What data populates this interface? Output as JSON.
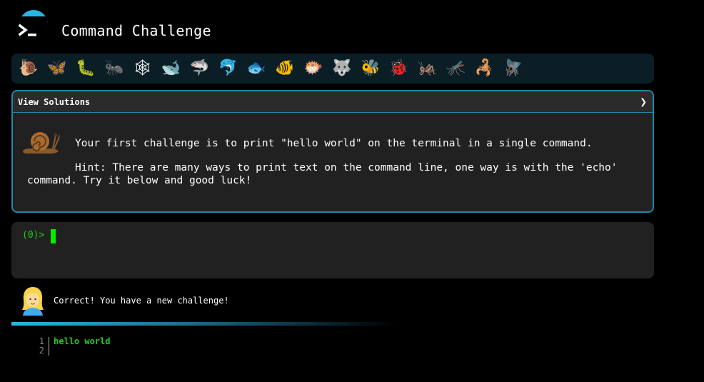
{
  "header": {
    "title": "Command Challenge",
    "logo_icon": "terminal-prompt-icon"
  },
  "animals": [
    {
      "name": "snail",
      "glyph": "🐌"
    },
    {
      "name": "butterfly",
      "glyph": "🦋"
    },
    {
      "name": "bug",
      "glyph": "🐛"
    },
    {
      "name": "ant",
      "glyph": "🐜"
    },
    {
      "name": "spider-web",
      "glyph": "🕸"
    },
    {
      "name": "whale",
      "glyph": "🐋"
    },
    {
      "name": "shark",
      "glyph": "🦈"
    },
    {
      "name": "dolphin",
      "glyph": "🐬"
    },
    {
      "name": "fish",
      "glyph": "🐟"
    },
    {
      "name": "tropical-fish",
      "glyph": "🐠"
    },
    {
      "name": "blowfish",
      "glyph": "🐡"
    },
    {
      "name": "wolf",
      "glyph": "🐺"
    },
    {
      "name": "bee",
      "glyph": "🐝"
    },
    {
      "name": "lady-beetle",
      "glyph": "🐞"
    },
    {
      "name": "cricket",
      "glyph": "🦗"
    },
    {
      "name": "mosquito",
      "glyph": "🦟"
    },
    {
      "name": "scorpion",
      "glyph": "🦂"
    },
    {
      "name": "fly",
      "glyph": "🪰"
    }
  ],
  "challenge": {
    "panel_label": "View Solutions",
    "chevron": "❯",
    "avatar_icon": "snail-icon",
    "text": "Your first challenge is to print \"hello world\" on the terminal in a single command.",
    "hint": "Hint: There are many ways to print text on the command line, one way is with the 'echo' command. Try it below and good luck!"
  },
  "terminal": {
    "prompt": "(0)>"
  },
  "feedback": {
    "avatar_icon": "woman-icon",
    "message": "Correct! You have a new challenge!"
  },
  "output": {
    "lines": [
      {
        "num": "1",
        "text": "hello world"
      },
      {
        "num": "2",
        "text": ""
      }
    ]
  },
  "colors": {
    "accent": "#29b6e6",
    "panel_border": "#1e88a8",
    "prompt_green": "#22cc22",
    "cursor_green": "#00ee00",
    "panel_bg": "#212121",
    "animal_bar_bg": "#0b1e26"
  }
}
